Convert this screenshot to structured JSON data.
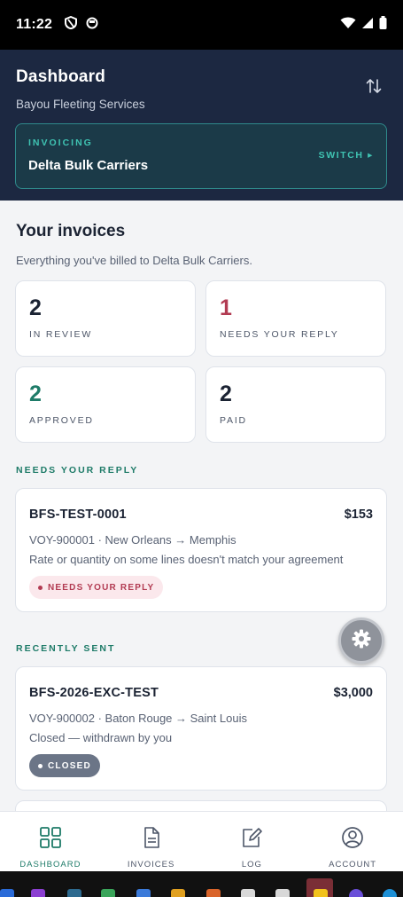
{
  "status_bar": {
    "time": "11:22"
  },
  "header": {
    "title": "Dashboard",
    "subtitle": "Bayou Fleeting Services",
    "invoicing_label": "INVOICING",
    "invoicing_name": "Delta Bulk Carriers",
    "switch_label": "SWITCH ▸"
  },
  "content": {
    "title": "Your invoices",
    "subtitle": "Everything you've billed to Delta Bulk Carriers.",
    "stats": [
      {
        "value": "2",
        "label": "IN REVIEW"
      },
      {
        "value": "1",
        "label": "NEEDS YOUR REPLY"
      },
      {
        "value": "2",
        "label": "APPROVED"
      },
      {
        "value": "2",
        "label": "PAID"
      }
    ],
    "needs_reply_label": "NEEDS YOUR REPLY",
    "recently_sent_label": "RECENTLY SENT",
    "invoices": [
      {
        "number": "BFS-TEST-0001",
        "amount": "$153",
        "route": "VOY-900001 · New Orleans → Memphis",
        "note": "Rate or quantity on some lines doesn't match your agreement",
        "badge": "NEEDS YOUR REPLY"
      },
      {
        "number": "BFS-2026-EXC-TEST",
        "amount": "$3,000",
        "route": "VOY-900002 · Baton Rouge → Saint Louis",
        "note": "Closed — withdrawn by you",
        "badge": "CLOSED"
      }
    ]
  },
  "nav": [
    {
      "label": "DASHBOARD",
      "icon": "grid-icon"
    },
    {
      "label": "INVOICES",
      "icon": "document-icon"
    },
    {
      "label": "LOG",
      "icon": "edit-icon"
    },
    {
      "label": "ACCOUNT",
      "icon": "account-icon"
    }
  ],
  "colors": {
    "header_bg": "#1c2841",
    "accent_teal": "#3fc3b2",
    "accent_green": "#1e7b68",
    "alert_red": "#b23b52"
  }
}
